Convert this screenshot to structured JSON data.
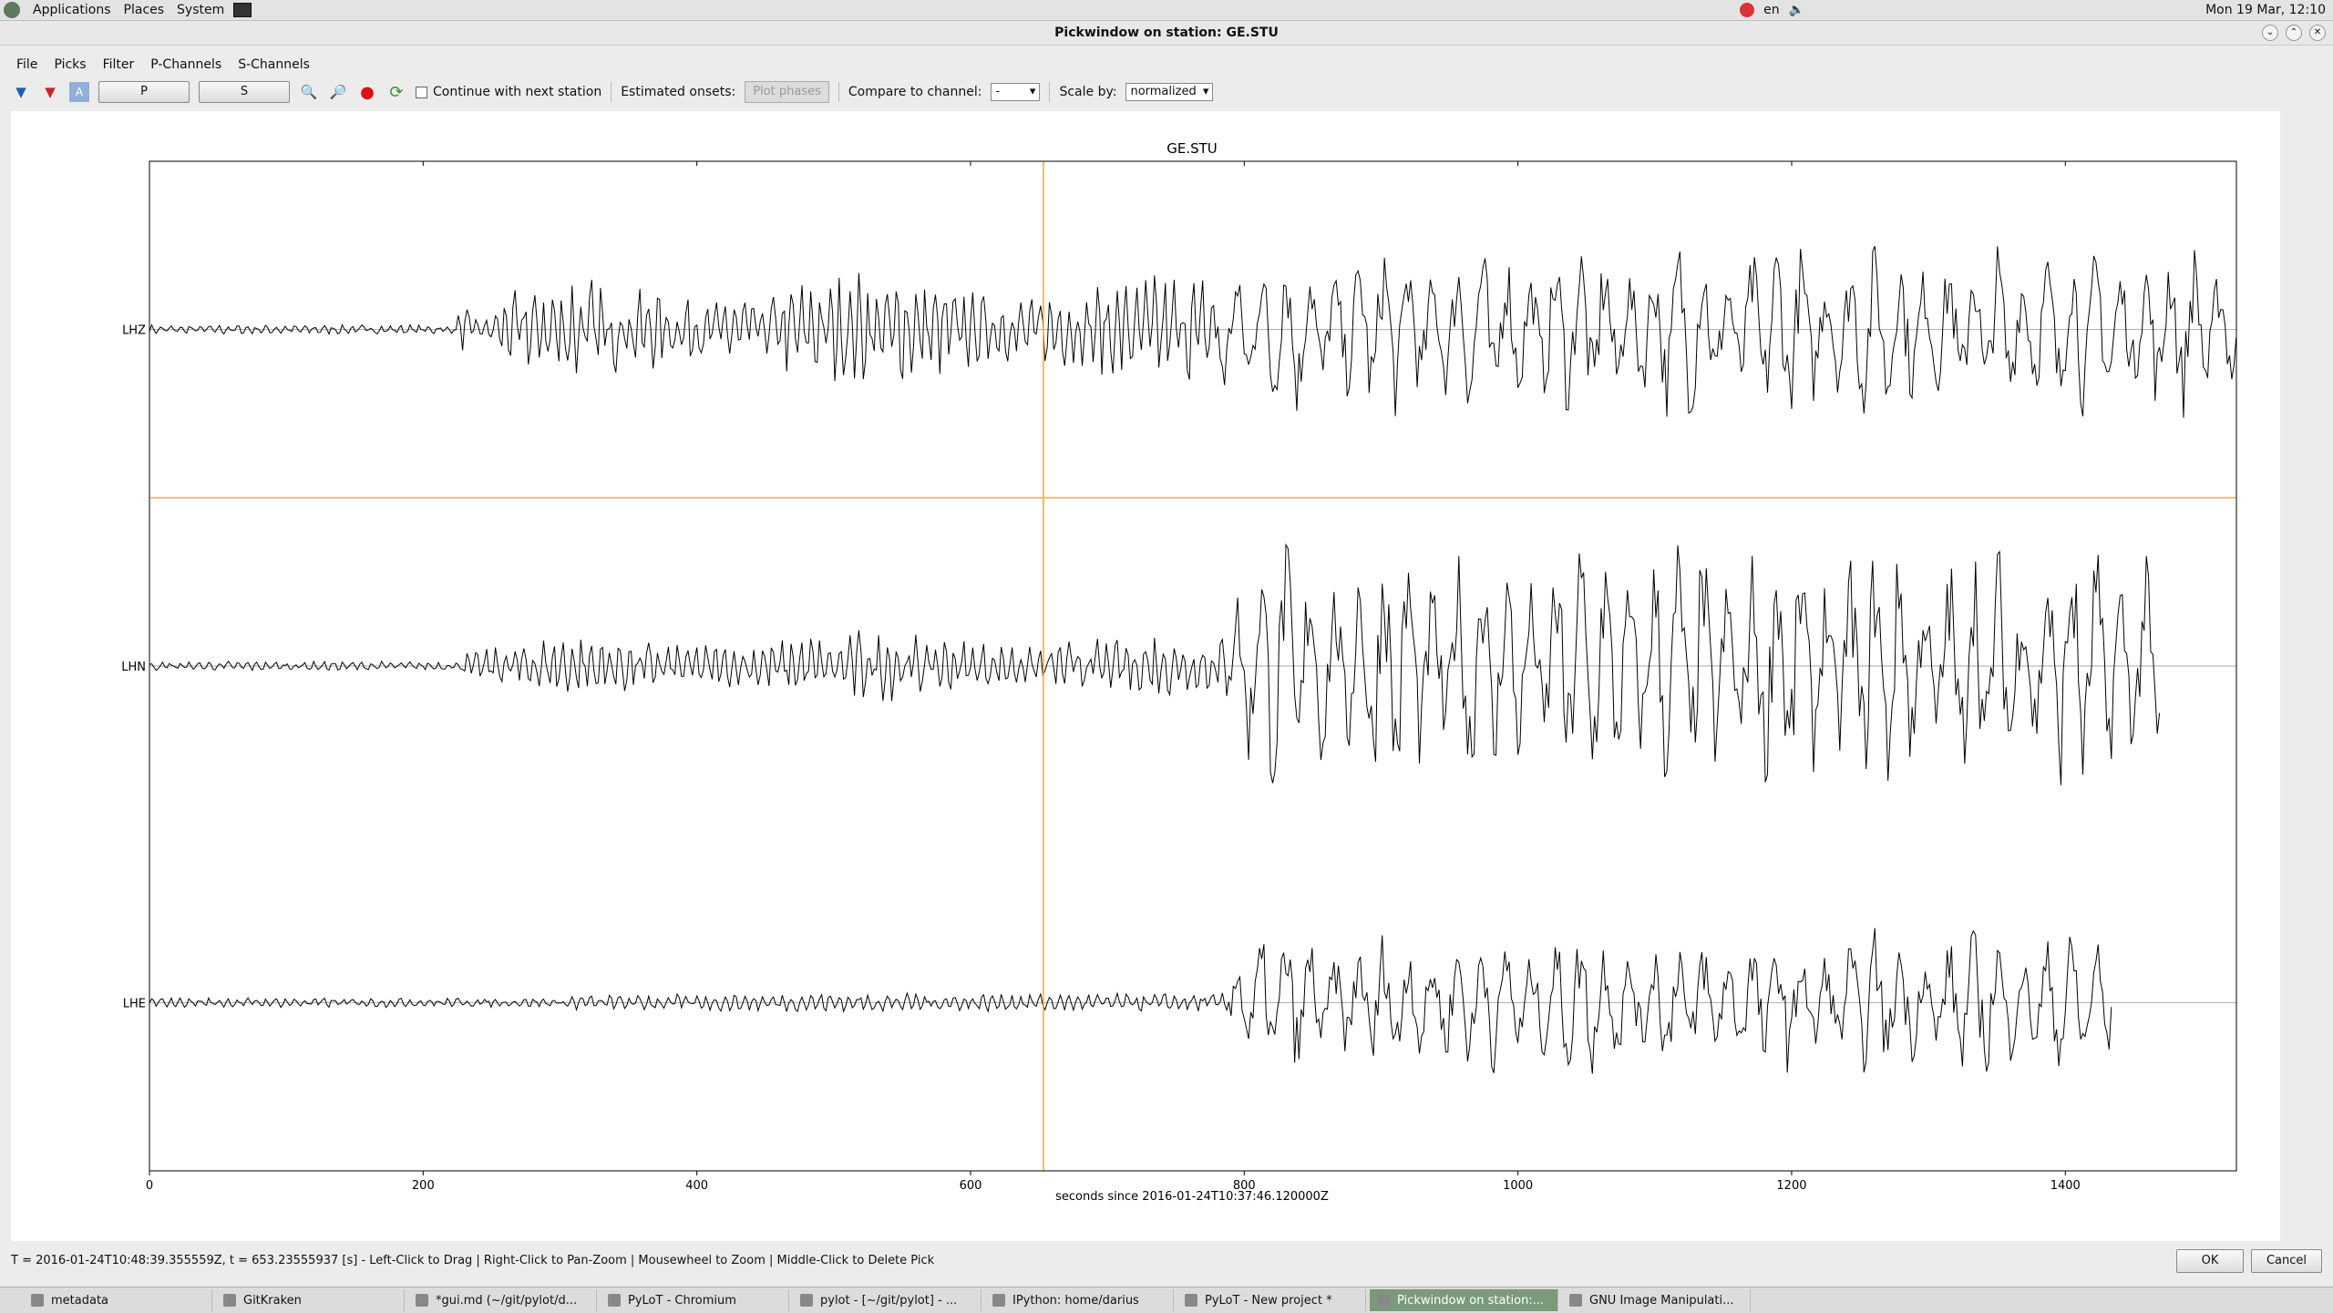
{
  "top_panel": {
    "menus": [
      "Applications",
      "Places",
      "System"
    ],
    "lang": "en",
    "clock": "Mon 19 Mar, 12:10"
  },
  "window": {
    "title": "Pickwindow on station: GE.STU"
  },
  "menubar": [
    "File",
    "Picks",
    "Filter",
    "P-Channels",
    "S-Channels"
  ],
  "toolbar": {
    "p_button": "P",
    "s_button": "S",
    "continue_label": "Continue with next station",
    "estimated_onsets_label": "Estimated onsets:",
    "plot_phases_button": "Plot phases",
    "compare_label": "Compare to channel:",
    "compare_value": "-",
    "scale_label": "Scale by:",
    "scale_value": "normalized"
  },
  "chart_data": {
    "type": "line",
    "title": "GE.STU",
    "xlabel": "seconds since 2016-01-24T10:37:46.120000Z",
    "ylabel": "",
    "xlim": [
      0,
      1525
    ],
    "x_ticks": [
      0,
      200,
      400,
      600,
      800,
      1000,
      1200,
      1400
    ],
    "channels": [
      "LHZ",
      "LHN",
      "LHE"
    ],
    "pick_time": 653.24,
    "colors": {
      "trace": "#000000",
      "pick": "#f2a93b",
      "baseline": "#aaaaaa"
    }
  },
  "status_bar": "T = 2016-01-24T10:48:39.355559Z, t = 653.23555937 [s] - Left-Click to Drag | Right-Click to Pan-Zoom | Mousewheel to Zoom | Middle-Click to Delete Pick",
  "dialog": {
    "ok": "OK",
    "cancel": "Cancel"
  },
  "taskbar": [
    {
      "label": "metadata",
      "active": false
    },
    {
      "label": "GitKraken",
      "active": false
    },
    {
      "label": "*gui.md (~/git/pylot/d...",
      "active": false
    },
    {
      "label": "PyLoT - Chromium",
      "active": false
    },
    {
      "label": "pylot - [~/git/pylot] - ...",
      "active": false
    },
    {
      "label": "IPython: home/darius",
      "active": false
    },
    {
      "label": "PyLoT - New project *",
      "active": false
    },
    {
      "label": "Pickwindow on station:...",
      "active": true
    },
    {
      "label": "GNU Image Manipulati...",
      "active": false
    }
  ]
}
